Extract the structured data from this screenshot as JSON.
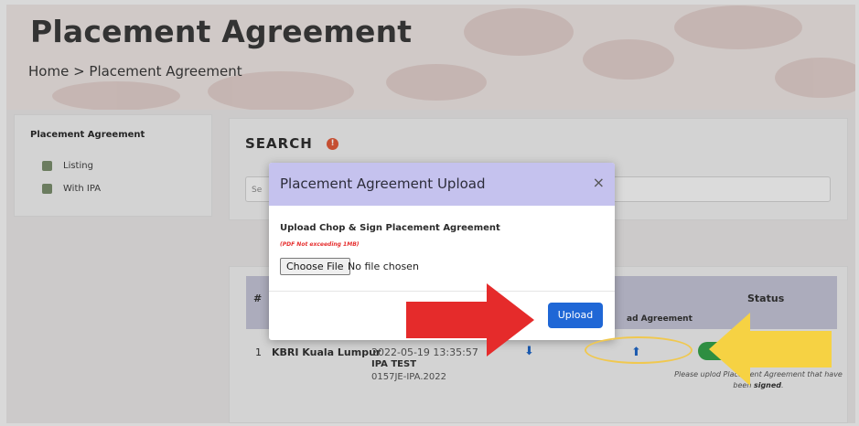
{
  "page": {
    "title": "Placement Agreement",
    "breadcrumb": "Home > Placement Agreement"
  },
  "sidebar": {
    "title": "Placement Agreement",
    "items": [
      {
        "label": "Listing",
        "icon": "folder-icon"
      },
      {
        "label": "With IPA",
        "icon": "folder-icon"
      }
    ]
  },
  "search": {
    "title": "SEARCH",
    "info_icon": "!",
    "placeholder": "Se"
  },
  "table": {
    "headers": {
      "hash": "#",
      "agreement": "ad Agreement",
      "status": "Status"
    },
    "rows": [
      {
        "num": "1",
        "name": "KBRI Kuala Lumpur",
        "date": "2022-05-19 13:35:57",
        "ipa": "IPA TEST",
        "ref": "0157JE-IPA.2022",
        "status_note_pre": "Please uplo",
        "status_note_mid": "d Placement Agreement that have been ",
        "status_note_bold": "signed",
        "status_note_end": "."
      }
    ]
  },
  "modal": {
    "title": "Placement Agreement Upload",
    "close": "×",
    "upload_label": "Upload Chop & Sign Placement Agreement",
    "upload_note": "(PDF Not exceeding 1MB)",
    "file_button": "Choose File",
    "file_status": "No file chosen",
    "upload_button": "Upload"
  },
  "colors": {
    "accent": "#1f67d6",
    "modal_header": "#c5c2ee",
    "red_arrow": "#e52b2b",
    "yellow_arrow": "#f6d243",
    "status_green": "#35a24a"
  }
}
